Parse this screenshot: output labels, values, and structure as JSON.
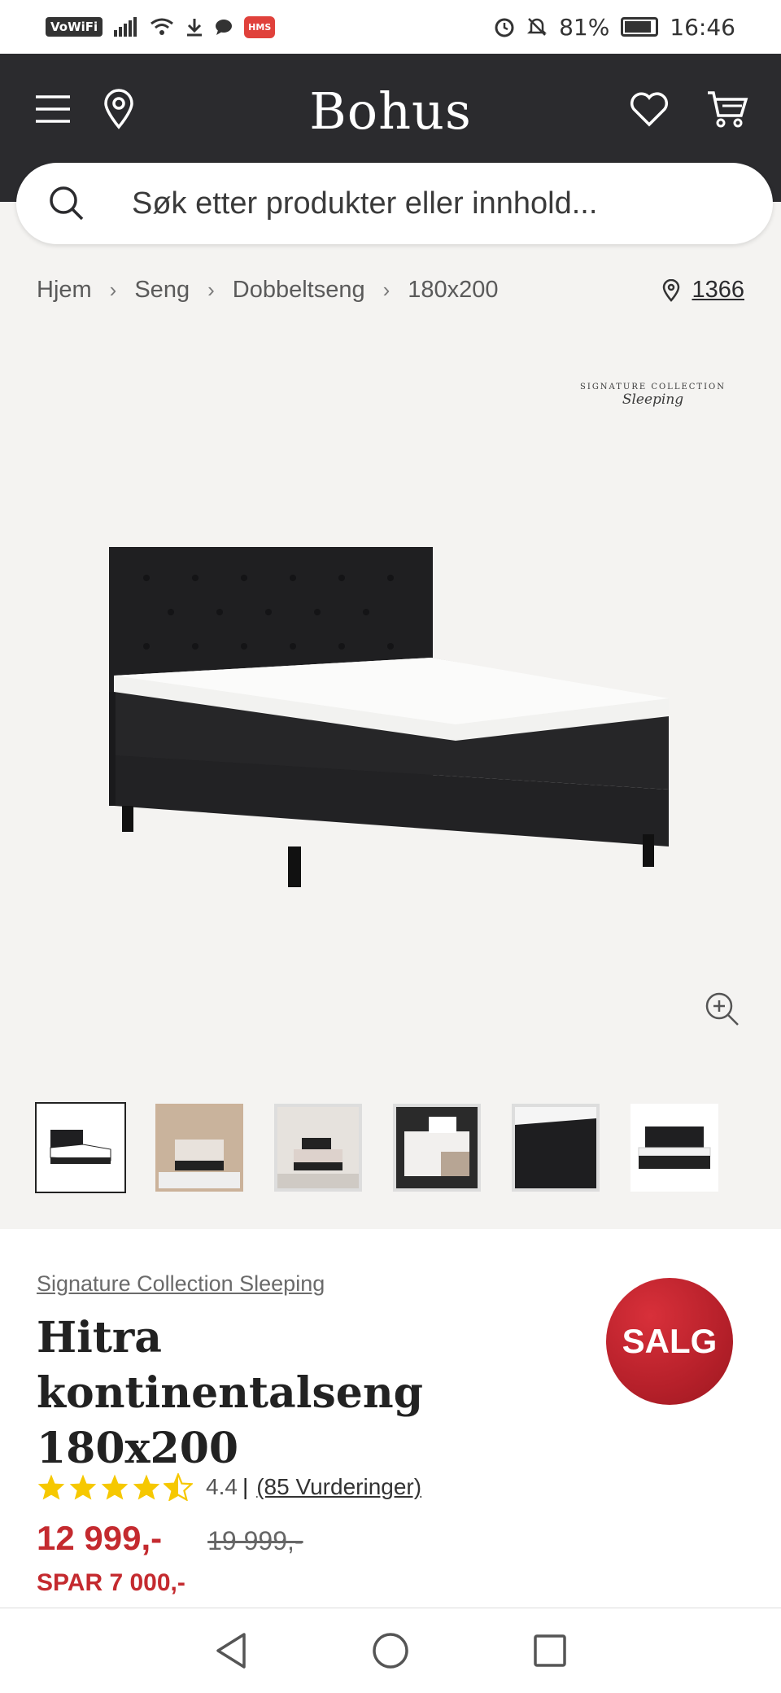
{
  "status_bar": {
    "vowifi": "VoWiFi",
    "hms": "HMS",
    "battery": "81%",
    "time": "16:46"
  },
  "header": {
    "logo": "Bohus",
    "icons": [
      "menu-icon",
      "location-pin-icon",
      "heart-icon",
      "cart-icon"
    ]
  },
  "search": {
    "placeholder": "Søk etter produkter eller innhold..."
  },
  "breadcrumb": {
    "items": [
      "Hjem",
      "Seng",
      "Dobbeltseng",
      "180x200"
    ],
    "store": "1366"
  },
  "hero": {
    "brand_mark_top": "SIGNATURE COLLECTION",
    "brand_mark_script": "Sleeping"
  },
  "thumbnails": {
    "count": 6,
    "active_index": 0
  },
  "product": {
    "brand": "Signature Collection Sleeping",
    "title_line1": "Hitra kontinentalseng",
    "title_line2": "180x200",
    "sale_badge": "SALG",
    "rating_value": "4.4",
    "rating_separator": "|",
    "rating_count": "(85 Vurderinger)",
    "rating_stars": 4.4,
    "price_now": "12 999,-",
    "price_old": "19 999,-",
    "savings": "SPAR 7 000,-"
  },
  "colors": {
    "header_bg": "#2b2b2e",
    "page_bg": "#f4f3f1",
    "sale_red": "#c42a2f",
    "star_yellow": "#f6c800"
  }
}
